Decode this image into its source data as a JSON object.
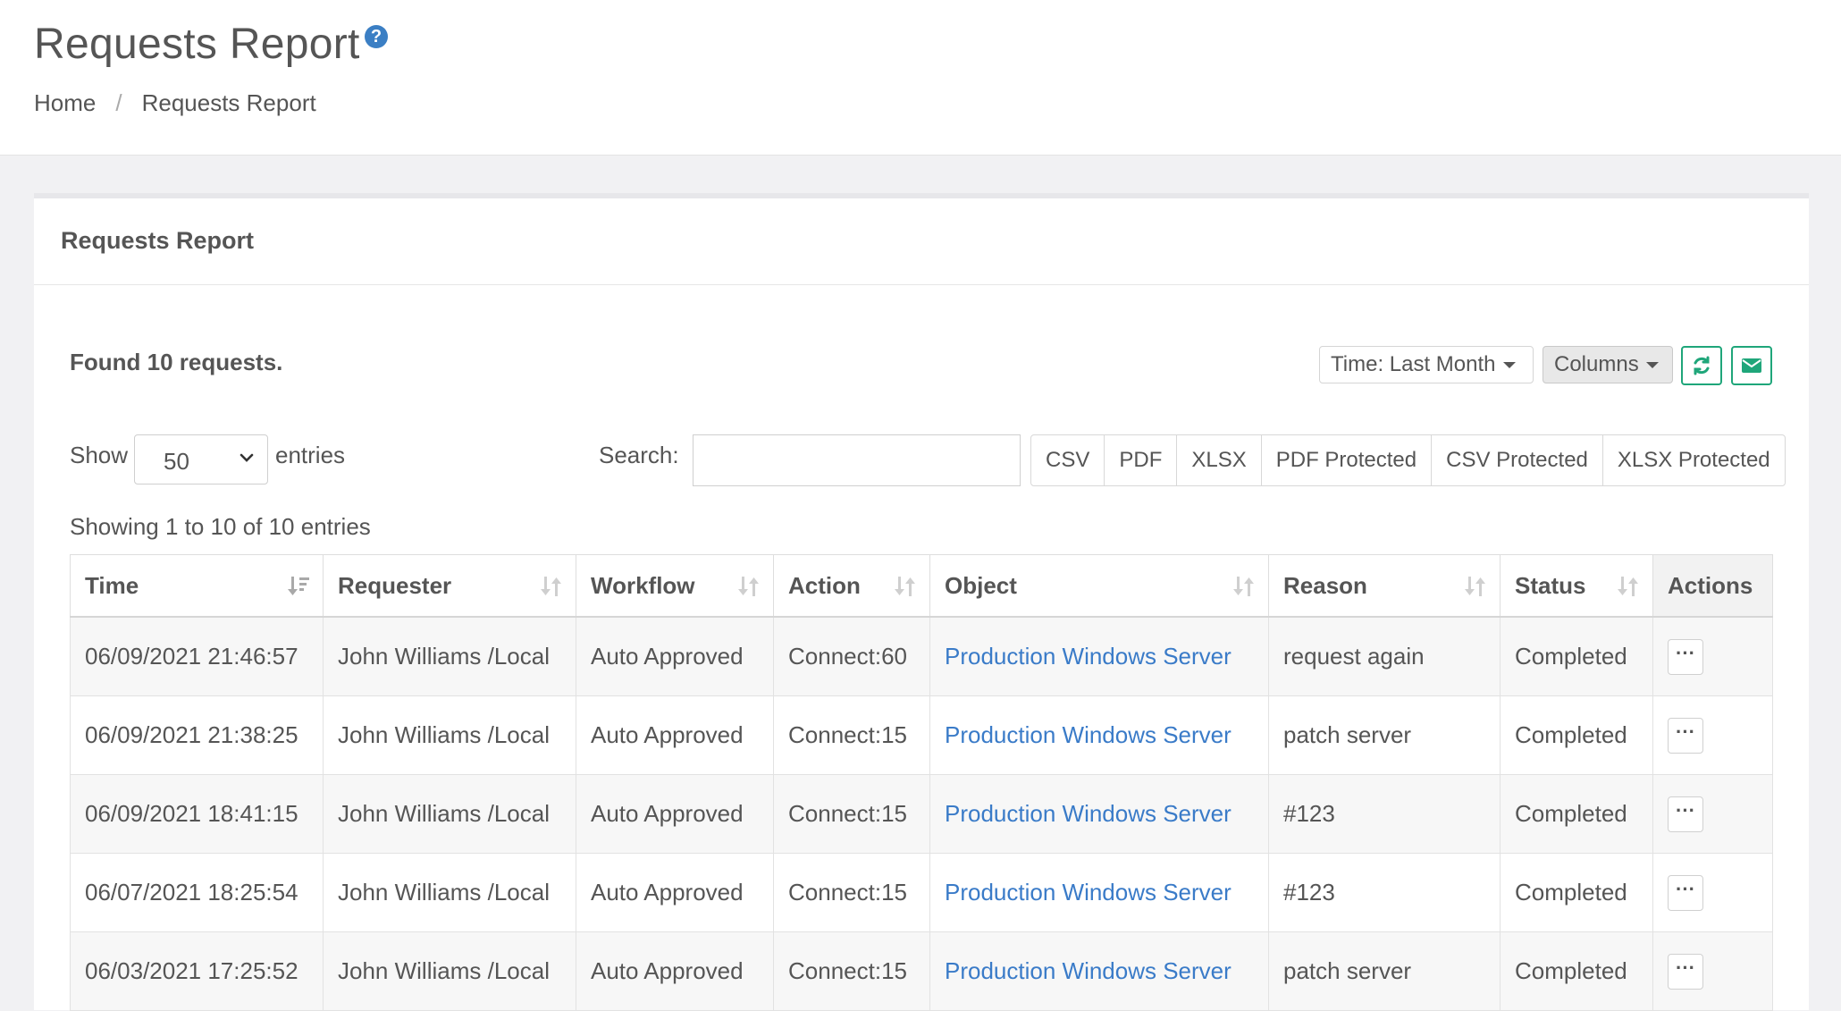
{
  "header": {
    "title": "Requests Report",
    "help_icon": "?",
    "breadcrumb": {
      "home": "Home",
      "separator": "/",
      "current": "Requests Report"
    }
  },
  "panel": {
    "title": "Requests Report",
    "found_text": "Found 10 requests.",
    "time_filter": "Time: Last Month",
    "columns_label": "Columns",
    "accent_color": "#1fa67a"
  },
  "controls": {
    "show_label": "Show",
    "entries_value": "50",
    "entries_label": "entries",
    "search_label": "Search:",
    "search_value": "",
    "export_buttons": [
      "CSV",
      "PDF",
      "XLSX",
      "PDF Protected",
      "CSV Protected",
      "XLSX Protected"
    ],
    "showing_info": "Showing 1 to 10 of 10 entries"
  },
  "table": {
    "headers": [
      "Time",
      "Requester",
      "Workflow",
      "Action",
      "Object",
      "Reason",
      "Status",
      "Actions"
    ],
    "rows": [
      [
        "06/09/2021 21:46:57",
        "John Williams /Local",
        "Auto Approved",
        "Connect:60",
        "Production Windows Server",
        "request again",
        "Completed"
      ],
      [
        "06/09/2021 21:38:25",
        "John Williams /Local",
        "Auto Approved",
        "Connect:15",
        "Production Windows Server",
        "patch server",
        "Completed"
      ],
      [
        "06/09/2021 18:41:15",
        "John Williams /Local",
        "Auto Approved",
        "Connect:15",
        "Production Windows Server",
        "#123",
        "Completed"
      ],
      [
        "06/07/2021 18:25:54",
        "John Williams /Local",
        "Auto Approved",
        "Connect:15",
        "Production Windows Server",
        "#123",
        "Completed"
      ],
      [
        "06/03/2021 17:25:52",
        "John Williams /Local",
        "Auto Approved",
        "Connect:15",
        "Production Windows Server",
        "patch server",
        "Completed"
      ]
    ],
    "row_action_label": "···"
  }
}
